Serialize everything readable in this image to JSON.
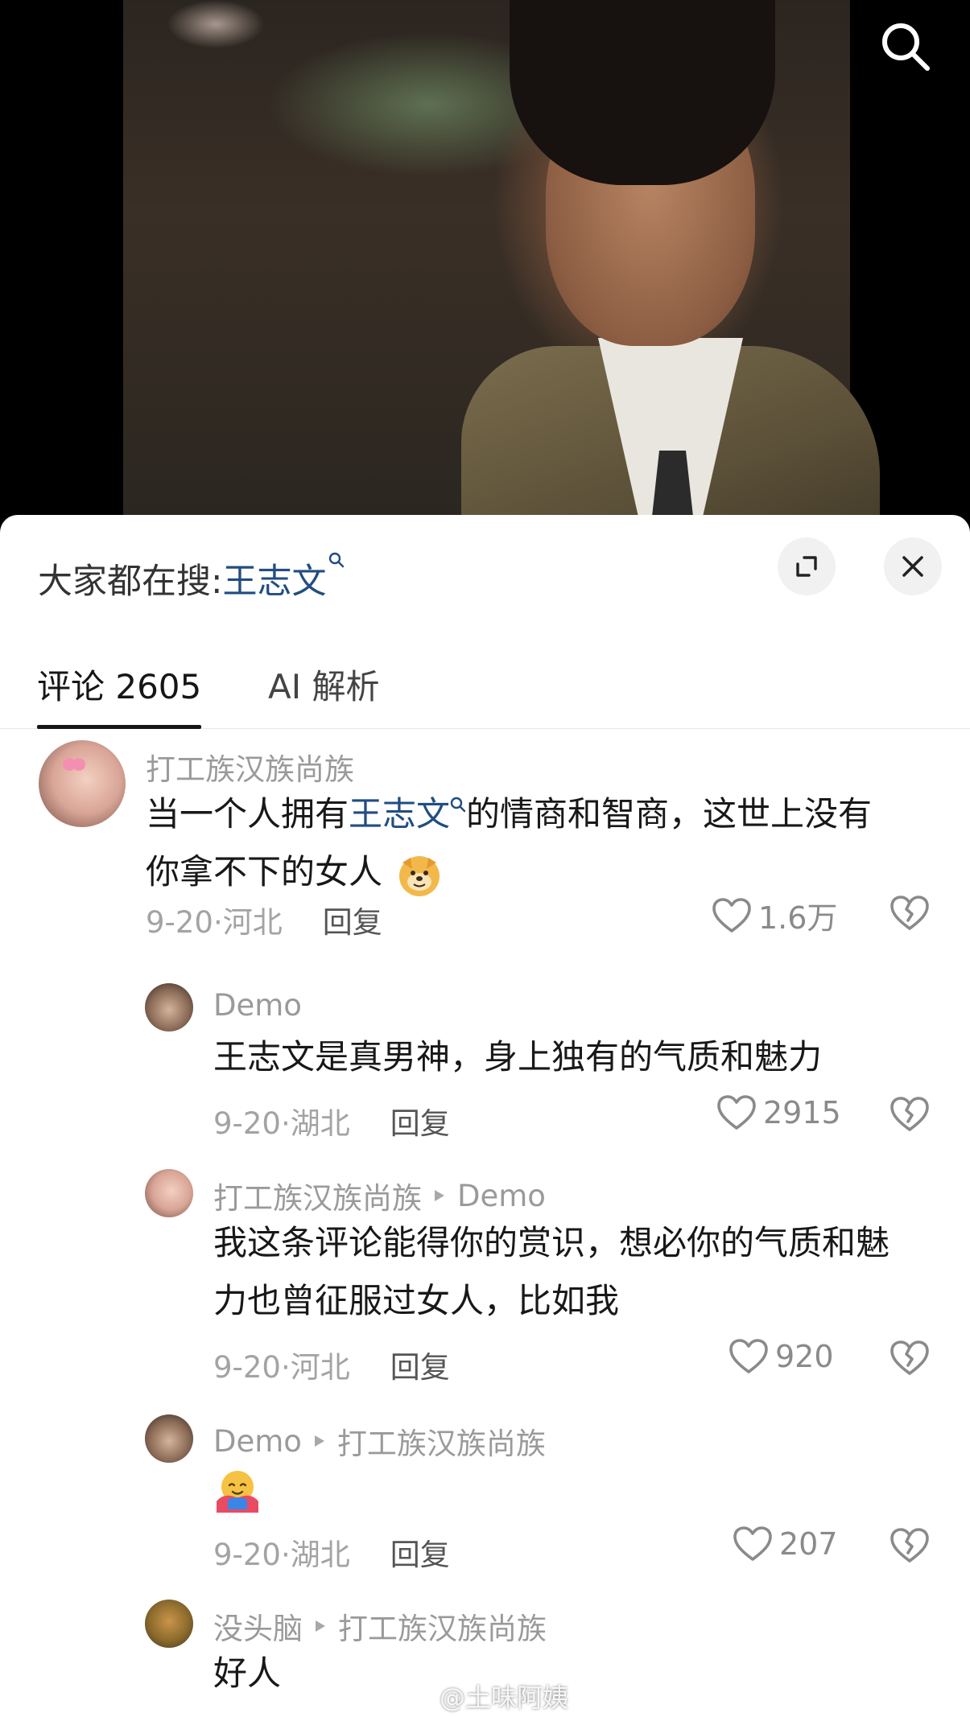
{
  "search_hint": {
    "prefix": "大家都在搜:",
    "keyword": "王志文"
  },
  "tabs": [
    {
      "label": "评论 2605",
      "active": true
    },
    {
      "label": "AI 解析",
      "active": false
    }
  ],
  "comments": [
    {
      "user": "打工族汉族尚族",
      "text_before": "当一个人拥有",
      "text_link": "王志文",
      "text_after_line1": "的情商和智商，这世上没有",
      "text_line2": "你拿不下的女人",
      "emoji": "doge",
      "date_loc": "9-20·河北",
      "reply_label": "回复",
      "likes": "1.6万"
    },
    {
      "user": "Demo",
      "text": "王志文是真男神，身上独有的气质和魅力",
      "date_loc": "9-20·湖北",
      "reply_label": "回复",
      "likes": "2915"
    },
    {
      "user": "打工族汉族尚族",
      "reply_to": "Demo",
      "text_line1": "我这条评论能得你的赏识，想必你的气质和魅",
      "text_line2": "力也曾征服过女人，比如我",
      "date_loc": "9-20·河北",
      "reply_label": "回复",
      "likes": "920"
    },
    {
      "user": "Demo",
      "reply_to": "打工族汉族尚族",
      "emoji": "hug",
      "date_loc": "9-20·湖北",
      "reply_label": "回复",
      "likes": "207"
    },
    {
      "user": "没头脑",
      "reply_to": "打工族汉族尚族",
      "text": "好人"
    }
  ],
  "watermark": "@土味阿姨",
  "colors": {
    "link": "#214d82",
    "muted": "#9a9a9a",
    "text": "#181818"
  }
}
